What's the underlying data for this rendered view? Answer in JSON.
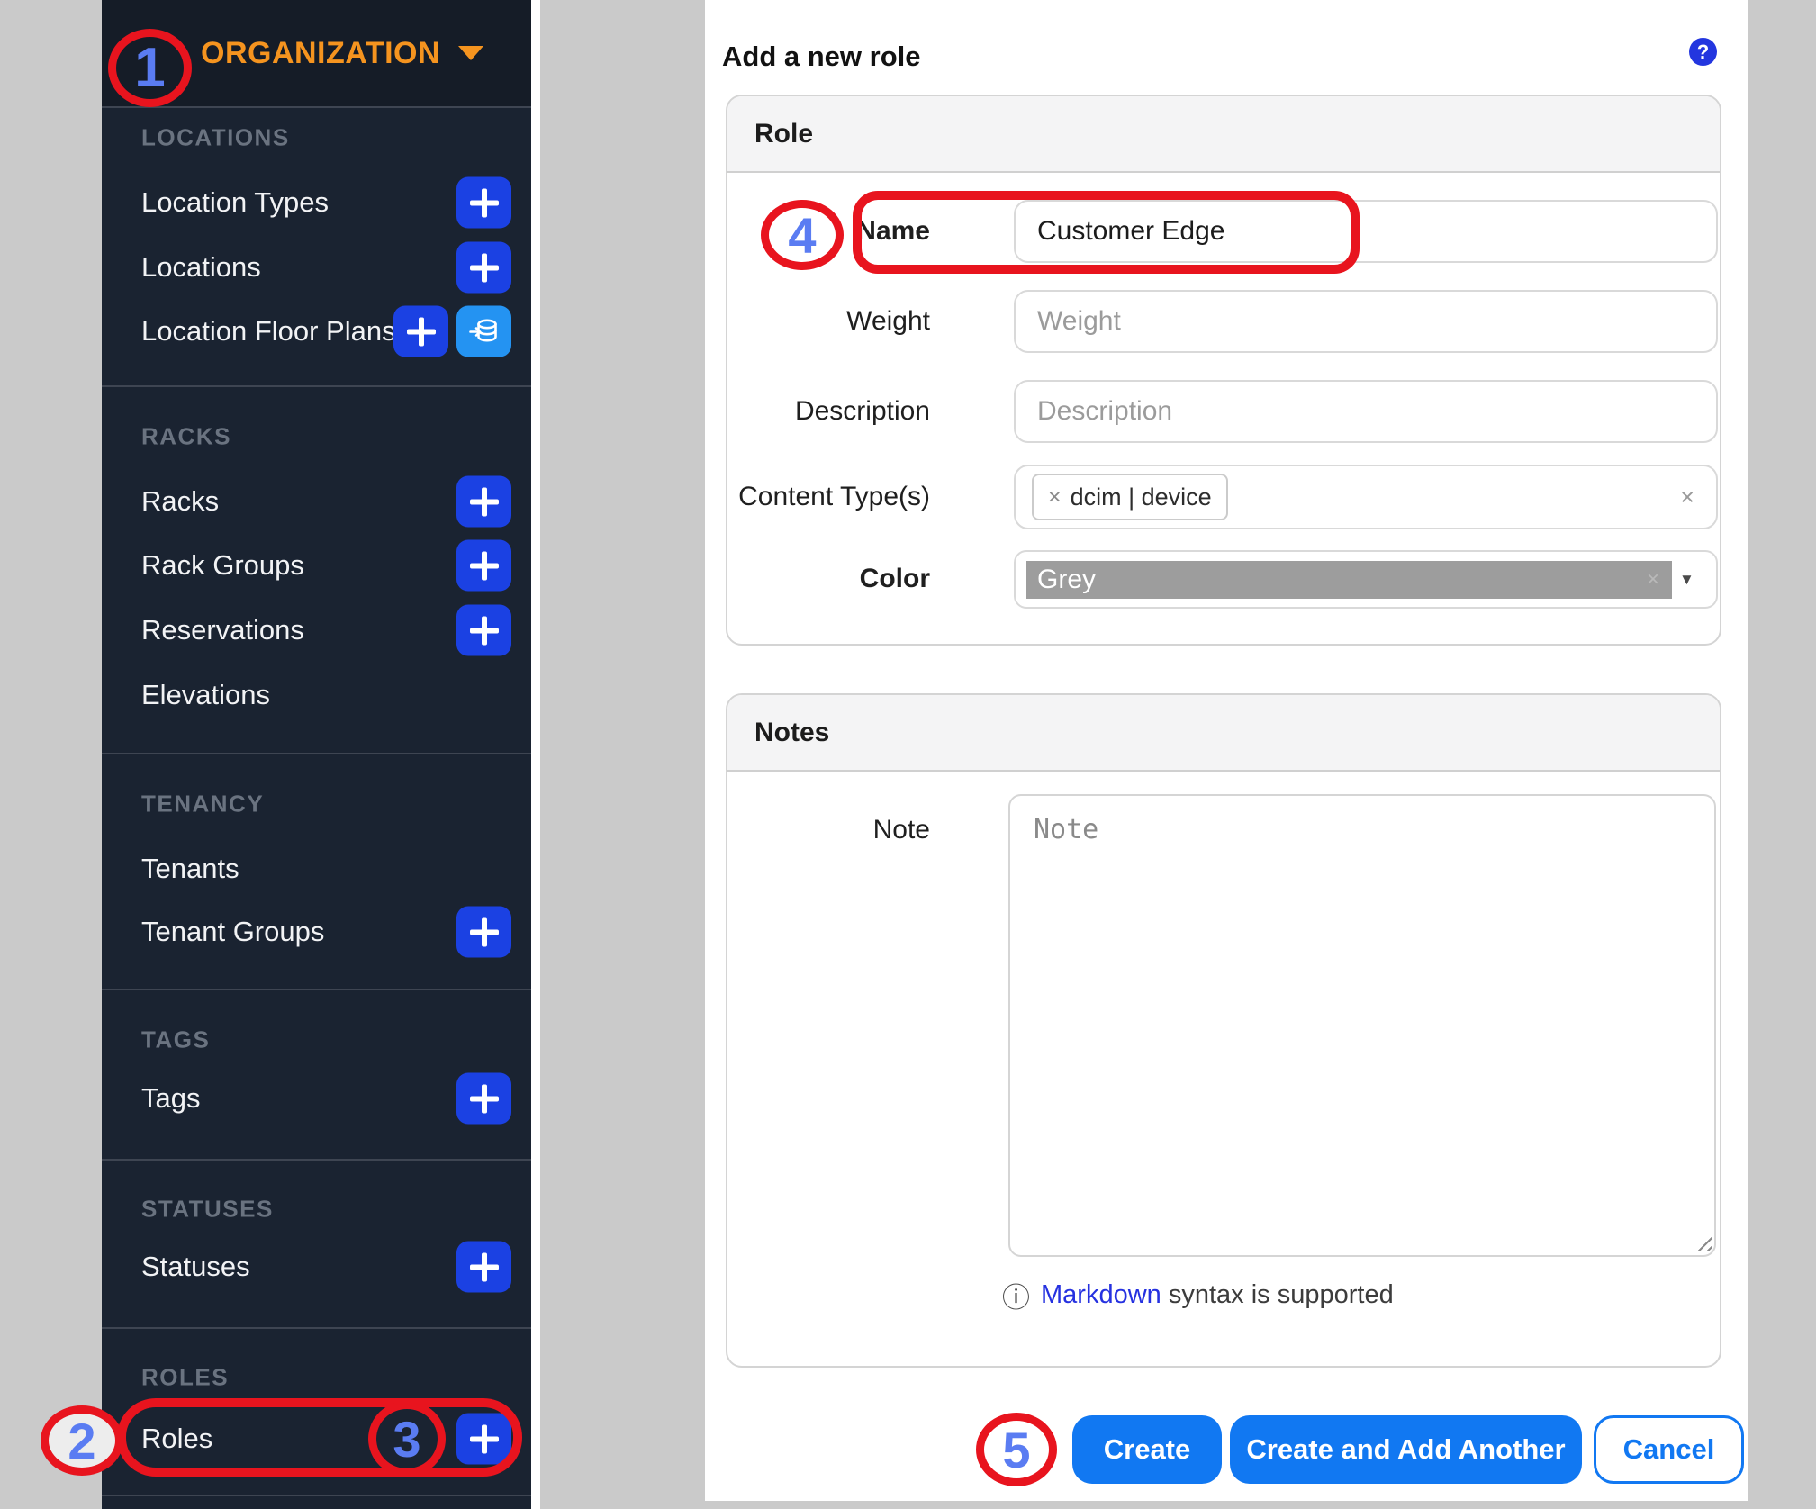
{
  "sidebar": {
    "title": "ORGANIZATION",
    "sections": [
      {
        "heading": "LOCATIONS",
        "items": [
          {
            "label": "Location Types",
            "add": true
          },
          {
            "label": "Locations",
            "add": true
          },
          {
            "label": "Location Floor Plans",
            "add": true,
            "import": true
          }
        ]
      },
      {
        "heading": "RACKS",
        "items": [
          {
            "label": "Racks",
            "add": true
          },
          {
            "label": "Rack Groups",
            "add": true
          },
          {
            "label": "Reservations",
            "add": true
          },
          {
            "label": "Elevations"
          }
        ]
      },
      {
        "heading": "TENANCY",
        "items": [
          {
            "label": "Tenants"
          },
          {
            "label": "Tenant Groups",
            "add": true
          }
        ]
      },
      {
        "heading": "TAGS",
        "items": [
          {
            "label": "Tags",
            "add": true
          }
        ]
      },
      {
        "heading": "STATUSES",
        "items": [
          {
            "label": "Statuses",
            "add": true
          }
        ]
      },
      {
        "heading": "ROLES",
        "items": [
          {
            "label": "Roles",
            "add": true
          }
        ]
      }
    ]
  },
  "panel": {
    "title": "Add a new role",
    "role_card": {
      "header": "Role",
      "name_label": "Name",
      "name_value": "Customer Edge",
      "weight_label": "Weight",
      "weight_placeholder": "Weight",
      "description_label": "Description",
      "description_placeholder": "Description",
      "content_types_label": "Content Type(s)",
      "content_types_tag": "dcim | device",
      "color_label": "Color",
      "color_value": "Grey"
    },
    "notes_card": {
      "header": "Notes",
      "note_label": "Note",
      "note_placeholder": "Note",
      "hint_link": "Markdown",
      "hint_rest": " syntax is supported"
    },
    "actions": {
      "create": "Create",
      "create_add": "Create and Add Another",
      "cancel": "Cancel"
    }
  },
  "icons": {
    "help": "?",
    "info": "ⓘ",
    "clear": "×",
    "tag_remove": "×",
    "color_remove": "×",
    "caret": "▼"
  },
  "annotations": {
    "step1": "1",
    "step2": "2",
    "step3": "3",
    "step4": "4",
    "step5": "5"
  },
  "colors": {
    "sidebar_bg": "#1a2331",
    "sidebar_header_bg": "#151c27",
    "accent_orange": "#f5941f",
    "add_button_blue": "#1b41e3",
    "import_button_blue": "#2493f2",
    "action_button_blue": "#1178f2",
    "annotation_red": "#e8141e",
    "annotation_number_blue": "#5a7cf2",
    "color_swatch_grey": "#9d9d9d"
  }
}
